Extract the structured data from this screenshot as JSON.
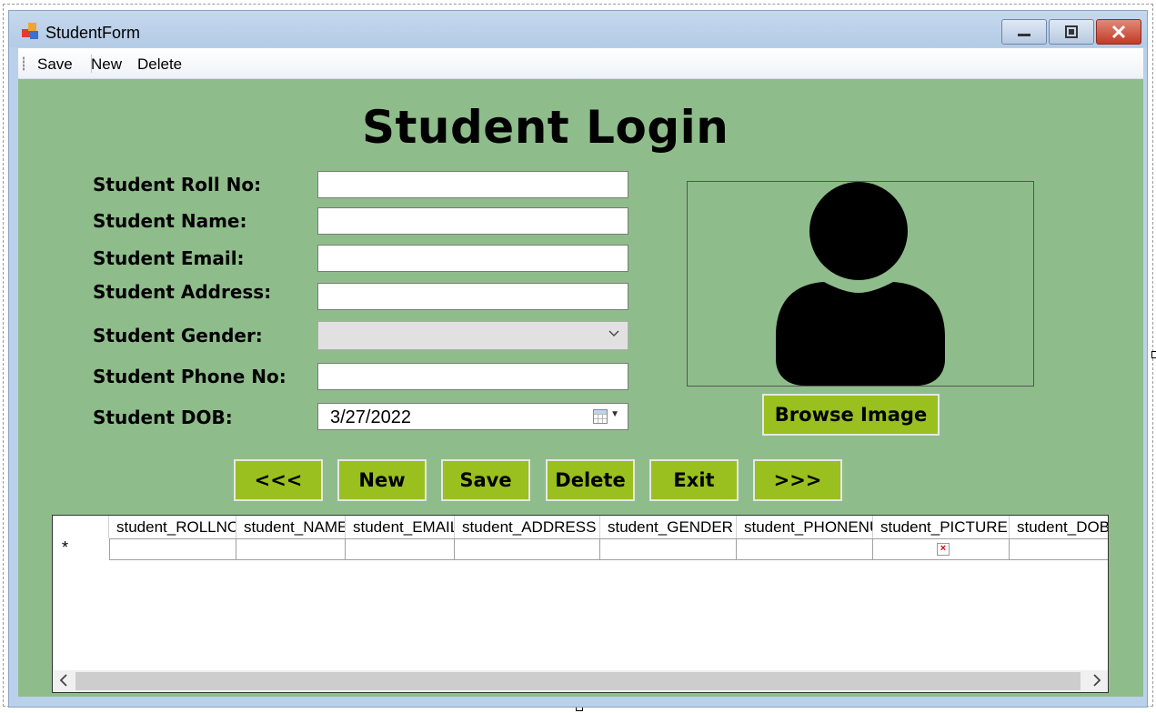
{
  "window": {
    "title": "StudentForm"
  },
  "menu": {
    "items": [
      "Save",
      "New",
      "Delete"
    ]
  },
  "form": {
    "heading": "Student Login",
    "fields": [
      {
        "label": "Student Roll No:",
        "value": ""
      },
      {
        "label": "Student Name:",
        "value": ""
      },
      {
        "label": "Student Email:",
        "value": ""
      },
      {
        "label": "Student Address:",
        "value": ""
      },
      {
        "label": "Student Gender:",
        "value": ""
      },
      {
        "label": "Student Phone No:",
        "value": ""
      },
      {
        "label": "Student DOB:",
        "value": "3/27/2022"
      }
    ],
    "browse_label": "Browse Image"
  },
  "nav_buttons": [
    "<<<",
    "New",
    "Save",
    "Delete",
    "Exit",
    ">>>"
  ],
  "grid": {
    "columns": [
      "student_ROLLNO",
      "student_NAME",
      "student_EMAIL",
      "student_ADDRESS",
      "student_GENDER",
      "student_PHONENU",
      "student_PICTURE",
      "student_DOB"
    ],
    "new_row_marker": "*"
  },
  "icons": [
    "app-icon",
    "minimize-icon",
    "maximize-icon",
    "close-icon",
    "calendar-icon",
    "chevron-down-icon",
    "user-silhouette-icon",
    "broken-image-icon"
  ],
  "colors": {
    "form_bg": "#8fbc8b",
    "button_bg": "#99c01f",
    "close_button": "#c23a26"
  }
}
